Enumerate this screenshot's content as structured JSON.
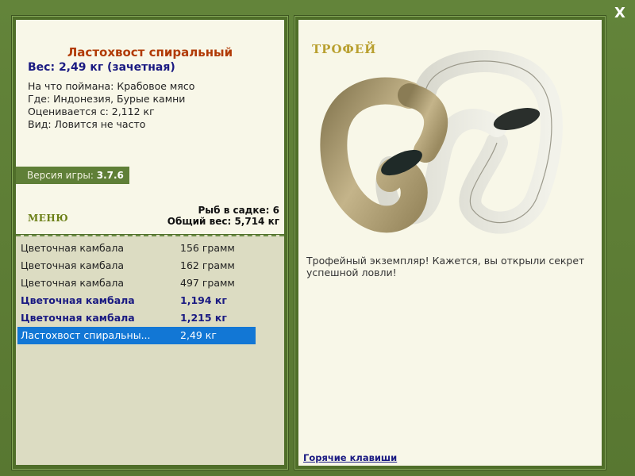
{
  "fish": {
    "title": "Ластохвост спиральный",
    "weight": "Вес: 2,49 кг (зачетная)",
    "caught_with": "На что поймана: Крабовое мясо",
    "where": "Где: Индонезия, Бурые камни",
    "rated_from": "Оценивается с: 2,112 кг",
    "kind": "Вид: Ловится не часто"
  },
  "version": {
    "label": "Версия игры:",
    "value": "3.7.6"
  },
  "menu": {
    "label": "МЕНЮ"
  },
  "cage": {
    "fish_count": "Рыб в садке: 6",
    "total_weight": "Общий вес: 5,714 кг"
  },
  "catches": [
    {
      "name": "Цветочная камбала",
      "weight": "156 грамм"
    },
    {
      "name": "Цветочная камбала",
      "weight": "162 грамм"
    },
    {
      "name": "Цветочная камбала",
      "weight": "497 грамм"
    },
    {
      "name": "Цветочная камбала",
      "weight": "1,194 кг"
    },
    {
      "name": "Цветочная камбала",
      "weight": "1,215 кг"
    },
    {
      "name": "Ластохвост спиральны...",
      "weight": "2,49 кг"
    }
  ],
  "trophy": {
    "label": "ТРОФЕЙ",
    "description": "Трофейный экземпляр! Кажется, вы открыли секрет успешной ловли!"
  },
  "hotkeys": {
    "label": "Горячие клавиши"
  },
  "close": {
    "label": "X"
  },
  "colors": {
    "frame": "#5a7a30",
    "title": "#b13a05",
    "accent_blue": "#1a1a82",
    "selection": "#1277d5"
  }
}
